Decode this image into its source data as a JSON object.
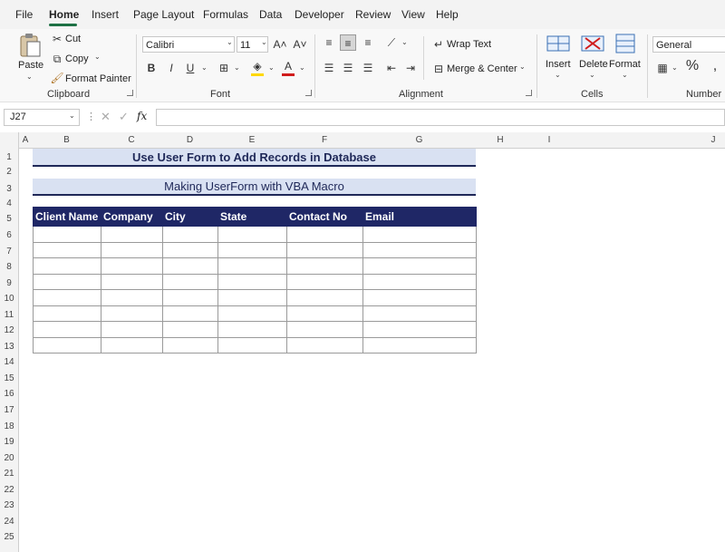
{
  "menu": {
    "items": [
      "File",
      "Home",
      "Insert",
      "Page Layout",
      "Formulas",
      "Data",
      "Developer",
      "Review",
      "View",
      "Help"
    ],
    "active": "Home"
  },
  "ribbon": {
    "clipboard": {
      "paste": "Paste",
      "cut": "Cut",
      "copy": "Copy",
      "format_painter": "Format Painter",
      "label": "Clipboard"
    },
    "font": {
      "name": "Calibri",
      "size": "11",
      "label": "Font",
      "bold": "B",
      "italic": "I",
      "underline": "U"
    },
    "alignment": {
      "wrap_text": "Wrap Text",
      "merge_center": "Merge & Center",
      "label": "Alignment"
    },
    "cells": {
      "insert": "Insert",
      "delete": "Delete",
      "format": "Format",
      "label": "Cells"
    },
    "number": {
      "format": "General",
      "percent": "%",
      "label": "Number"
    }
  },
  "formula_bar": {
    "name_box": "J27",
    "fx": "fx",
    "formula": ""
  },
  "columns": [
    "A",
    "B",
    "C",
    "D",
    "E",
    "F",
    "G",
    "H",
    "I",
    "J"
  ],
  "rows": [
    "1",
    "2",
    "3",
    "4",
    "5",
    "6",
    "7",
    "8",
    "9",
    "10",
    "11",
    "12",
    "13",
    "14",
    "15",
    "16",
    "17",
    "18",
    "19",
    "20",
    "21",
    "22",
    "23",
    "24",
    "25"
  ],
  "sheet": {
    "title": "Use User Form to Add Records in Database",
    "subtitle": "Making UserForm with VBA Macro",
    "headers": [
      "Client Name",
      "Company",
      "City",
      "State",
      "Contact No",
      "Email"
    ],
    "data_rows": [
      [
        "",
        "",
        "",
        "",
        "",
        ""
      ],
      [
        "",
        "",
        "",
        "",
        "",
        ""
      ],
      [
        "",
        "",
        "",
        "",
        "",
        ""
      ],
      [
        "",
        "",
        "",
        "",
        "",
        ""
      ],
      [
        "",
        "",
        "",
        "",
        "",
        ""
      ],
      [
        "",
        "",
        "",
        "",
        "",
        ""
      ],
      [
        "",
        "",
        "",
        "",
        "",
        ""
      ],
      [
        "",
        "",
        "",
        "",
        "",
        ""
      ]
    ]
  },
  "colors": {
    "accent": "#1e7145",
    "header_fill": "#1f2766",
    "title_fill": "#d9e1f2"
  }
}
